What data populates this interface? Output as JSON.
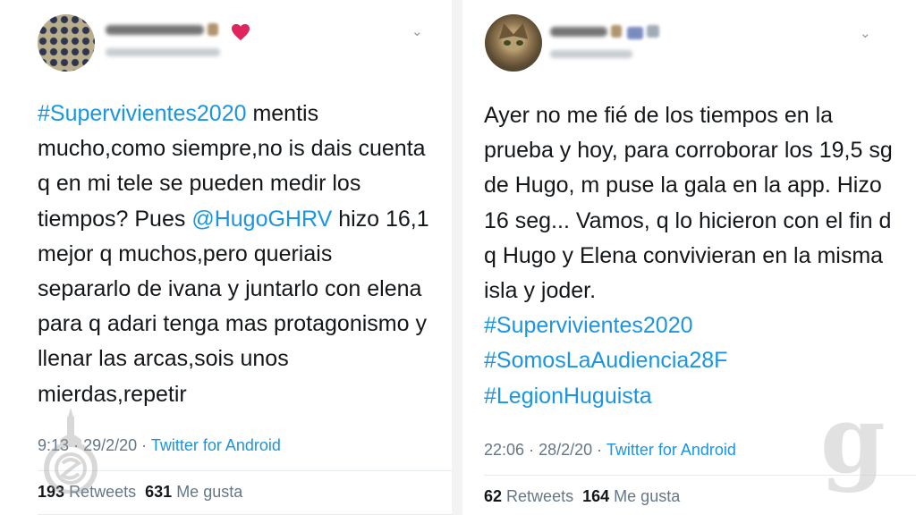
{
  "left_tweet": {
    "avatar": "polka-dot-avatar",
    "emoji_after_name": [
      "figure-emoji",
      "red-heart-emoji"
    ],
    "heart_color": "#e0245e",
    "text_parts": [
      {
        "type": "hashtag",
        "text": "#Supervivientes2020"
      },
      {
        "type": "text",
        "text": " mentis mucho,como siempre,no is dais cuenta q en mi tele se pueden medir los tiempos? Pues "
      },
      {
        "type": "mention",
        "text": "@HugoGHRV"
      },
      {
        "type": "text",
        "text": " hizo 16,1 mejor q muchos,pero queriais separarlo de ivana y juntarlo con elena para q adari tenga mas protagonismo y llenar las arcas,sois unos mierdas,repetir"
      }
    ],
    "time": "9:13",
    "separator": "·",
    "date": "29/2/20",
    "source": "Twitter for Android",
    "retweets_count": "193",
    "retweets_label": "Retweets",
    "likes_count": "631",
    "likes_label": "Me gusta"
  },
  "right_tweet": {
    "avatar": "tabby-cat-avatar",
    "text_parts": [
      {
        "type": "text",
        "text": "Ayer no me fié de los tiempos en la prueba y hoy, para corroborar los 19,5 sg de Hugo, m puse la gala en la app. Hizo 16 seg... Vamos, q lo hicieron con el fin d q Hugo y Elena convivieran en la misma isla y joder."
      },
      {
        "type": "hashtag",
        "text": "#Supervivientes2020"
      },
      {
        "type": "hashtag",
        "text": "#SomosLaAudiencia28F"
      },
      {
        "type": "hashtag",
        "text": "#LegionHuguista"
      }
    ],
    "time": "22:06",
    "separator": "·",
    "date": "28/2/20",
    "source": "Twitter for Android",
    "retweets_count": "62",
    "retweets_label": "Retweets",
    "likes_count": "164",
    "likes_label": "Me gusta"
  },
  "chevron_icon": "⌄",
  "watermark_g": "g",
  "colors": {
    "link": "#1b95e0",
    "text": "#14171a",
    "muted": "#657786",
    "divider": "#e6ecf0"
  }
}
